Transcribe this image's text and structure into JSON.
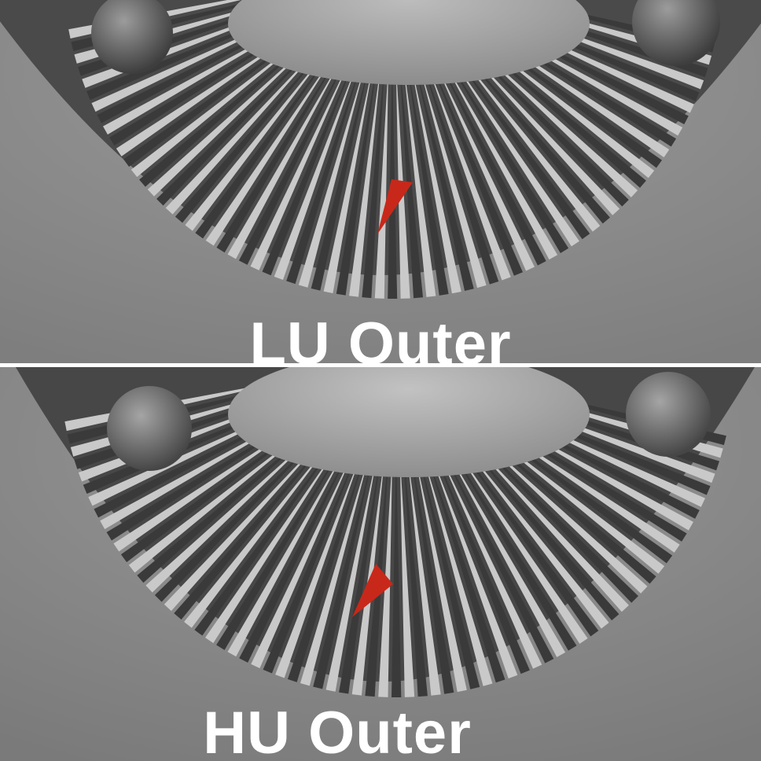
{
  "panels": {
    "top": {
      "caption": "LU Outer"
    },
    "bottom": {
      "caption": "HU Outer"
    }
  },
  "colors": {
    "background": "#8f8f8f",
    "blade_light": "#c9c9c9",
    "blade_dark": "#3a3a3a",
    "marker": "#c8281a",
    "caption": "#ffffff"
  }
}
